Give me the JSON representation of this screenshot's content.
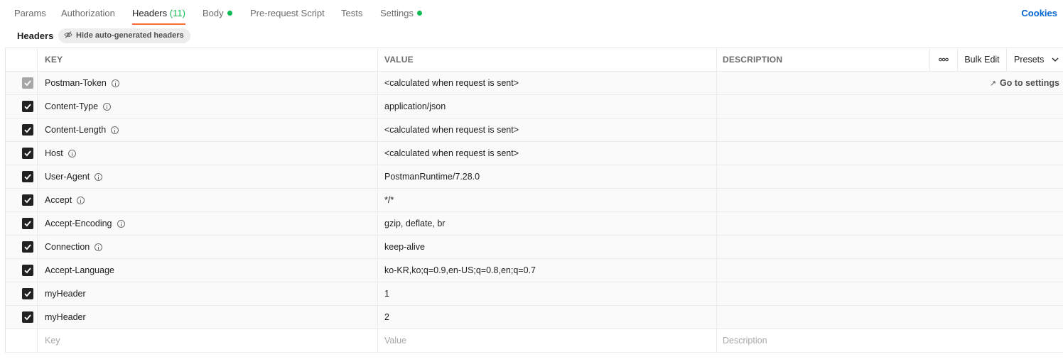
{
  "tabs": [
    {
      "label": "Params"
    },
    {
      "label": "Authorization"
    },
    {
      "label": "Headers",
      "count": "(11)",
      "active": true
    },
    {
      "label": "Body",
      "dot": true
    },
    {
      "label": "Pre-request Script"
    },
    {
      "label": "Tests"
    },
    {
      "label": "Settings",
      "dot": true
    }
  ],
  "cookies_label": "Cookies",
  "subheader": {
    "title": "Headers",
    "hide_button": "Hide auto-generated headers"
  },
  "table": {
    "columns": {
      "key": "KEY",
      "value": "VALUE",
      "description": "DESCRIPTION"
    },
    "actions": {
      "more": "ooo",
      "bulk_edit": "Bulk Edit",
      "presets": "Presets"
    },
    "go_to_settings": "Go to settings",
    "rows": [
      {
        "key": "Postman-Token",
        "value": "<calculated when request is sent>",
        "info": true,
        "checked": true,
        "disabled": true
      },
      {
        "key": "Content-Type",
        "value": "application/json",
        "info": true,
        "checked": true
      },
      {
        "key": "Content-Length",
        "value": "<calculated when request is sent>",
        "info": true,
        "checked": true
      },
      {
        "key": "Host",
        "value": "<calculated when request is sent>",
        "info": true,
        "checked": true
      },
      {
        "key": "User-Agent",
        "value": "PostmanRuntime/7.28.0",
        "info": true,
        "checked": true
      },
      {
        "key": "Accept",
        "value": "*/*",
        "info": true,
        "checked": true
      },
      {
        "key": "Accept-Encoding",
        "value": "gzip, deflate, br",
        "info": true,
        "checked": true
      },
      {
        "key": "Connection",
        "value": "keep-alive",
        "info": true,
        "checked": true
      },
      {
        "key": "Accept-Language",
        "value": "ko-KR,ko;q=0.9,en-US;q=0.8,en;q=0.7",
        "info": false,
        "checked": true
      },
      {
        "key": "myHeader",
        "value": "1",
        "info": false,
        "checked": true
      },
      {
        "key": "myHeader",
        "value": "2",
        "info": false,
        "checked": true
      }
    ],
    "placeholders": {
      "key": "Key",
      "value": "Value",
      "description": "Description"
    }
  },
  "colors": {
    "accent": "#ff6c37",
    "green": "#0cbb52",
    "link": "#0265d2"
  }
}
